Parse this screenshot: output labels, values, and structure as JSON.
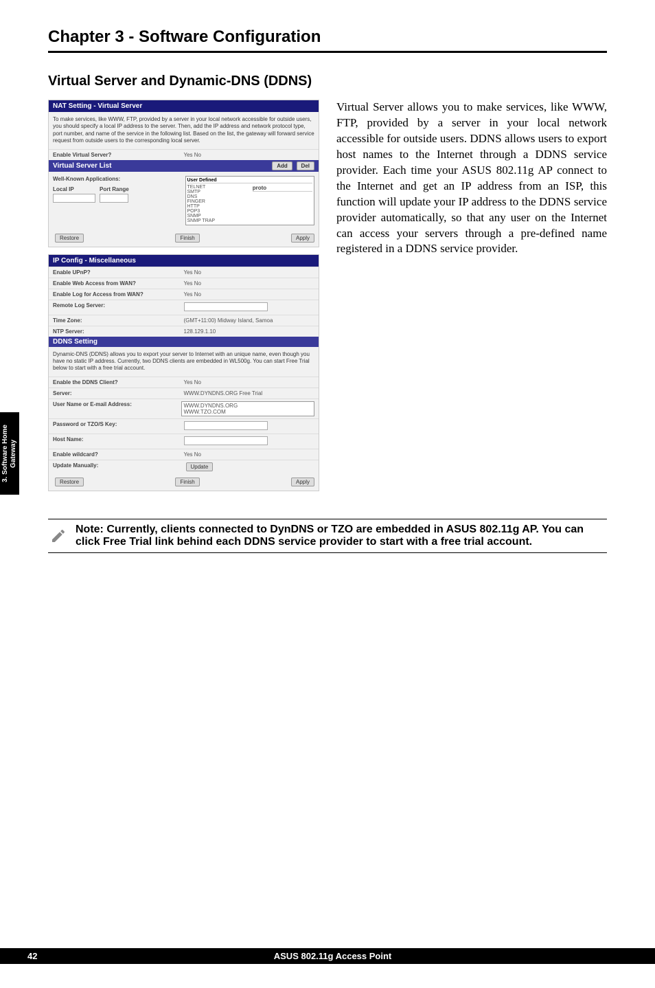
{
  "chapter": "Chapter 3 - Software Configuration",
  "section": "Virtual Server and Dynamic-DNS (DDNS)",
  "body_text": "Virtual Server allows you to make services, like WWW, FTP, provided by a server in your local network accessible for outside users. DDNS allows users to export host names to the Internet through a DDNS service provider. Each time your ASUS 802.11g AP connect to the Internet and get an IP address from an ISP, this function will update your IP address to the DDNS service provider automatically, so that any user on the Internet can access your servers through a pre-defined name registered in a DDNS service provider.",
  "note": "Note: Currently, clients connected to DynDNS or TZO are embedded in ASUS 802.11g AP. You can click Free Trial link behind each DDNS service provider to start with a free trial account.",
  "sidetab": "3. Software\nHome Gateway",
  "footer_page": "42",
  "footer_title": "ASUS 802.11g Access Point",
  "shot1": {
    "title": "NAT Setting - Virtual Server",
    "desc": "To make services, like WWW, FTP, provided by a server in your local network accessible for outside users, you should specify a local IP address to the server. Then, add the IP address and network protocol type, port number, and name of the service in the following list. Based on the list, the gateway will forward service request from outside users to the corresponding local server.",
    "enable_label": "Enable Virtual Server?",
    "enable_val": "Yes  No",
    "list_title": "Virtual Server List",
    "btn_add": "Add",
    "btn_del": "Del",
    "wk_label": "Well-Known Applications:",
    "wk_sel": "User Defined",
    "localip": "Local IP",
    "portrange": "Port Range",
    "proto": "proto",
    "wk_items": [
      "TELNET",
      "SMTP",
      "DNS",
      "FINGER",
      "HTTP",
      "POP3",
      "SNMP",
      "SNMP TRAP"
    ],
    "btn_restore": "Restore",
    "btn_finish": "Finish",
    "btn_apply": "Apply"
  },
  "shot2": {
    "title": "IP Config - Miscellaneous",
    "rows1": [
      {
        "l": "Enable UPnP?",
        "v": "Yes  No"
      },
      {
        "l": "Enable Web Access from WAN?",
        "v": "Yes  No"
      },
      {
        "l": "Enable Log for Access from WAN?",
        "v": "Yes  No"
      },
      {
        "l": "Remote Log Server:",
        "v": ""
      },
      {
        "l": "Time Zone:",
        "v": "(GMT+11:00) Midway Island, Samoa"
      },
      {
        "l": "NTP Server:",
        "v": "128.129.1.10"
      }
    ],
    "ddns_title": "DDNS Setting",
    "ddns_desc": "Dynamic-DNS (DDNS) allows you to export your server to Internet with an unique name, even though you have no static IP address. Currently, two DDNS clients are embedded in WL500g. You can start Free Trial below to start with a free trial account.",
    "rows2": [
      {
        "l": "Enable the DDNS Client?",
        "v": "Yes  No"
      },
      {
        "l": "Server:",
        "v": "WWW.DYNDNS.ORG   Free Trial"
      },
      {
        "l": "User Name or E-mail Address:",
        "v": "WWW.DYNDNS.ORG\nWWW.TZO.COM"
      },
      {
        "l": "Password or TZO/S Key:",
        "v": ""
      },
      {
        "l": "Host Name:",
        "v": ""
      },
      {
        "l": "Enable wildcard?",
        "v": "Yes  No"
      },
      {
        "l": "Update Manually:",
        "v": "Update"
      }
    ],
    "btn_restore": "Restore",
    "btn_finish": "Finish",
    "btn_apply": "Apply"
  }
}
